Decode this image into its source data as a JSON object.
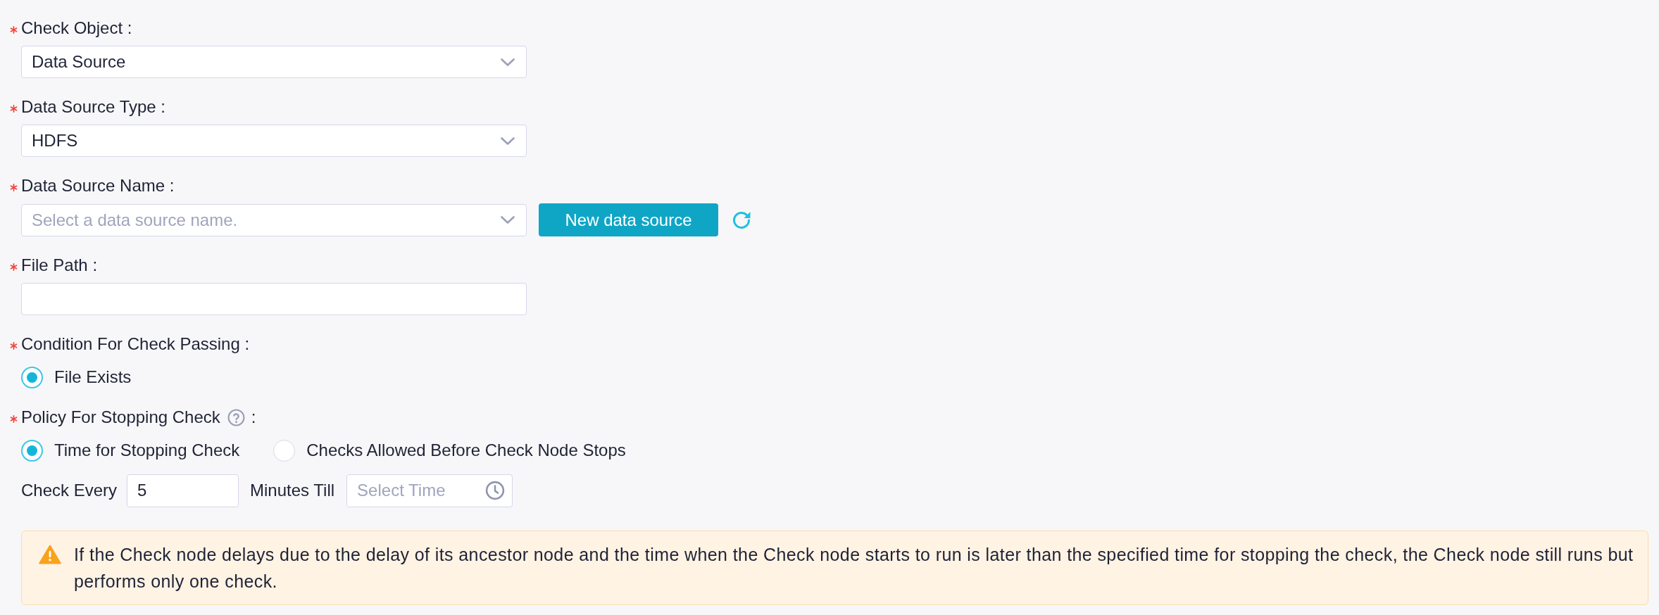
{
  "fields": [
    {
      "kind": "select",
      "required": true,
      "label": "Check Object :",
      "value": "Data Source"
    },
    {
      "kind": "select",
      "required": true,
      "label": "Data Source Type :",
      "value": "HDFS"
    },
    {
      "kind": "select_with_action",
      "required": true,
      "label": "Data Source Name :",
      "placeholder": "Select a data source name.",
      "button": "New data source"
    },
    {
      "kind": "input",
      "required": true,
      "label": "File Path :"
    },
    {
      "kind": "radio_group",
      "required": true,
      "label": "Condition For Check Passing :",
      "options": [
        {
          "label": "File Exists",
          "selected": true
        }
      ]
    },
    {
      "kind": "radio_group",
      "required": true,
      "label": "Policy For Stopping Check",
      "help_icon": true,
      "label_end": ":",
      "options": [
        {
          "label": "Time for Stopping Check",
          "selected": true
        },
        {
          "label": "Checks Allowed Before Check Node Stops",
          "selected": false
        }
      ],
      "schedule": {
        "prefix": "Check Every",
        "interval": "5",
        "unit": "Minutes Till",
        "time_placeholder": "Select Time"
      }
    }
  ],
  "notice": {
    "text": "If the Check node delays due to the delay of its ancestor node and the time when the Check node starts to run is later than the specified time for stopping the check, the Check node still runs but performs only one check."
  }
}
